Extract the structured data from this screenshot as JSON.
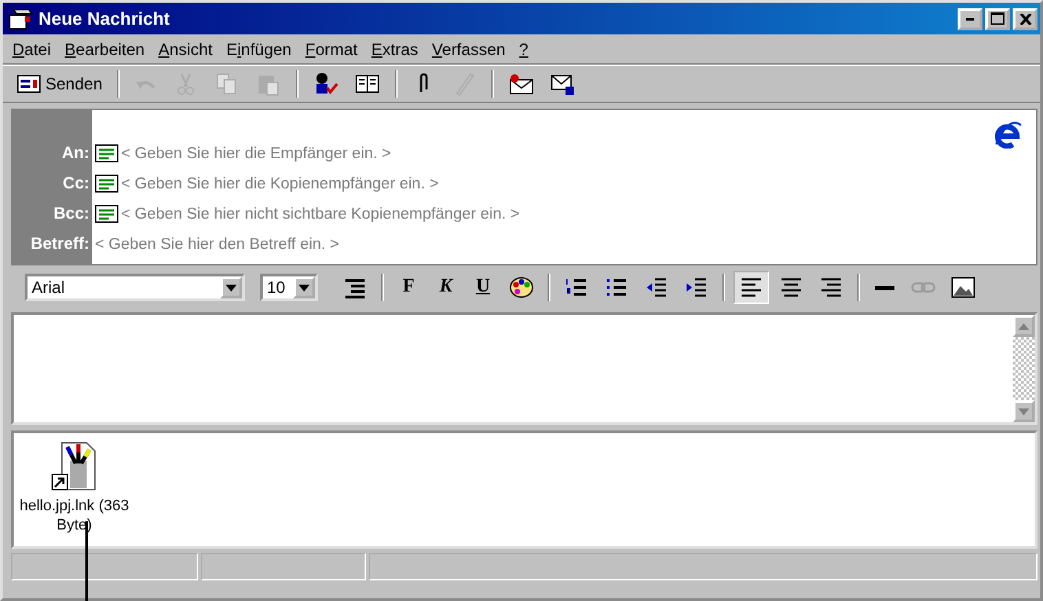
{
  "window": {
    "title": "Neue Nachricht"
  },
  "menu": [
    {
      "key": "D",
      "after": "atei"
    },
    {
      "key": "B",
      "after": "earbeiten"
    },
    {
      "key": "A",
      "after": "nsicht"
    },
    {
      "before": "E",
      "key": "i",
      "after": "nfügen"
    },
    {
      "key": "F",
      "after": "ormat"
    },
    {
      "key": "E",
      "after": "xtras"
    },
    {
      "key": "V",
      "after": "erfassen"
    },
    {
      "key": "?"
    }
  ],
  "toolbar": [
    {
      "kind": "send",
      "label": "Senden",
      "disabled": false
    },
    {
      "kind": "separator"
    },
    {
      "kind": "undo",
      "disabled": true
    },
    {
      "kind": "cut",
      "disabled": true
    },
    {
      "kind": "copy",
      "disabled": true
    },
    {
      "kind": "paste",
      "disabled": true
    },
    {
      "kind": "separator"
    },
    {
      "kind": "check",
      "disabled": false
    },
    {
      "kind": "book",
      "disabled": false
    },
    {
      "kind": "separator"
    },
    {
      "kind": "clip",
      "disabled": false
    },
    {
      "kind": "pen",
      "disabled": true
    },
    {
      "kind": "separator"
    },
    {
      "kind": "sign",
      "disabled": false
    },
    {
      "kind": "lock",
      "disabled": false
    }
  ],
  "header_fields": [
    {
      "label": "An:",
      "book": true,
      "placeholder": "< Geben Sie hier die Empfänger ein. >"
    },
    {
      "label": "Cc:",
      "book": true,
      "placeholder": "< Geben Sie hier die Kopienempfänger ein. >"
    },
    {
      "label": "Bcc:",
      "book": true,
      "placeholder": "< Geben Sie hier nicht sichtbare Kopienempfänger ein. >"
    },
    {
      "label": "Betreff:",
      "book": false,
      "placeholder": "< Geben Sie hier den Betreff ein. >"
    }
  ],
  "format_bar": {
    "font": "Arial",
    "size": "10",
    "items": [
      {
        "kind": "indent-style",
        "selected": false
      },
      {
        "kind": "separator"
      },
      {
        "kind": "bold",
        "text": "F",
        "selected": false
      },
      {
        "kind": "italic",
        "text": "K",
        "selected": false
      },
      {
        "kind": "underline",
        "text": "U",
        "selected": false
      },
      {
        "kind": "palette",
        "selected": false
      },
      {
        "kind": "separator"
      },
      {
        "kind": "numbered",
        "selected": false
      },
      {
        "kind": "bullets",
        "selected": false
      },
      {
        "kind": "outdent",
        "selected": false
      },
      {
        "kind": "indent",
        "selected": false
      },
      {
        "kind": "separator"
      },
      {
        "kind": "align-left",
        "selected": true
      },
      {
        "kind": "align-center",
        "selected": false
      },
      {
        "kind": "align-right",
        "selected": false
      },
      {
        "kind": "separator"
      },
      {
        "kind": "rule",
        "selected": false
      },
      {
        "kind": "link",
        "selected": false,
        "disabled": true
      },
      {
        "kind": "image",
        "selected": false
      }
    ]
  },
  "attachments": [
    {
      "name": "hello.jpj.lnk (363 Byte)"
    }
  ]
}
